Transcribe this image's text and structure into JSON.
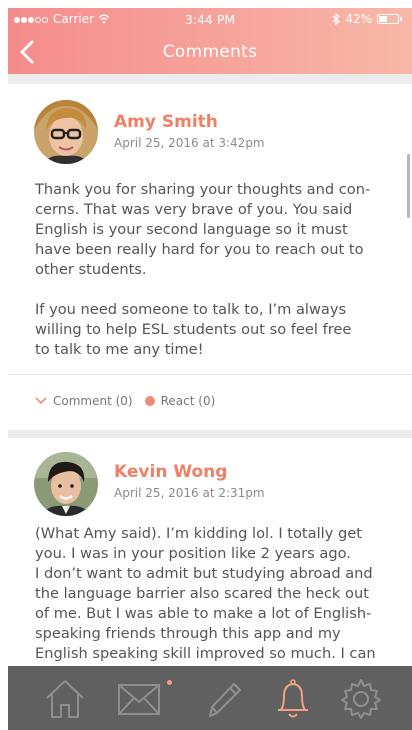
{
  "status_bar": {
    "carrier": "Carrier",
    "time": "3:44 PM",
    "battery": "42%"
  },
  "header": {
    "title": "Comments"
  },
  "comments": [
    {
      "author": "Amy Smith",
      "date": "April 25, 2016 at 3:42pm",
      "text": "Thank you for sharing your thoughts and con-\ncerns. That was very brave of you. You said\nEnglish is your second language so it must\nhave been really hard for you to reach out to\nother students.\n\nIf you need someone to talk to, I’m always\nwilling to help ESL students out so feel free\nto talk to me any time!",
      "comment_label": "Comment (0)",
      "react_label": "React (0)"
    },
    {
      "author": "Kevin Wong",
      "date": "April 25, 2016 at 2:31pm",
      "text": "(What Amy said). I’m kidding lol. I totally get\nyou. I was in your position like 2 years ago.\nI don’t want to admit but studying abroad and\nthe language barrier also scared the heck out\nof me. But I was able to make a lot of English-\nspeaking friends through this app and my\nEnglish speaking skill improved so much. I can\nguarantee that you’re in the right community"
    }
  ],
  "tabbar": {
    "icons": [
      "home-icon",
      "mail-icon",
      "pencil-icon",
      "bell-icon",
      "gear-icon"
    ],
    "active": "bell-icon"
  },
  "colors": {
    "accent": "#ef8066",
    "header_start": "#f58c8c",
    "header_end": "#f8b8a8",
    "tabbar": "#606060"
  }
}
